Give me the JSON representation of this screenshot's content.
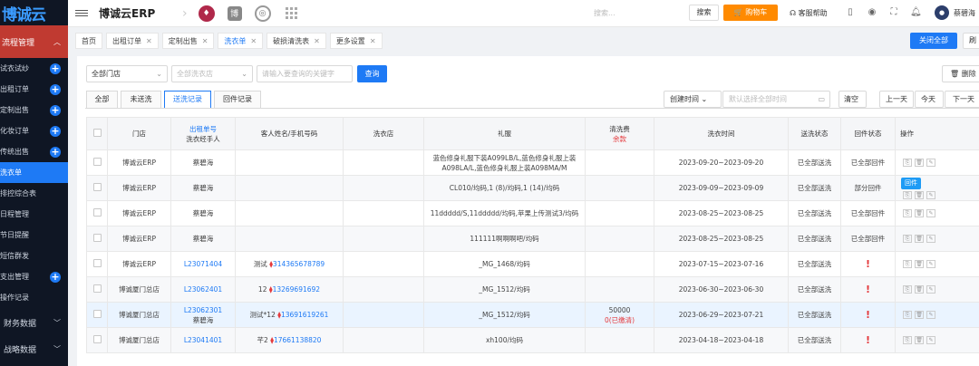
{
  "sidebar": {
    "logo": "博诚云",
    "group": "流程管理",
    "items": [
      {
        "label": "试衣试纱",
        "plus": true
      },
      {
        "label": "出租订单",
        "plus": true
      },
      {
        "label": "定制出售",
        "plus": true
      },
      {
        "label": "化妆订单",
        "plus": true
      },
      {
        "label": "传统出售",
        "plus": true
      },
      {
        "label": "洗衣单",
        "plus": false,
        "active": true
      },
      {
        "label": "排控综合表",
        "plus": false
      },
      {
        "label": "日程管理",
        "plus": false
      },
      {
        "label": "节日提醒",
        "plus": false
      },
      {
        "label": "短信群发",
        "plus": false
      },
      {
        "label": "支出管理",
        "plus": true
      },
      {
        "label": "操作记录",
        "plus": false
      }
    ],
    "sections": [
      "财务数据",
      "战略数据"
    ]
  },
  "topbar": {
    "brand": "博诚云ERP",
    "search_placeholder": "搜索...",
    "search_label": "搜索",
    "cart_label": "购物车",
    "help_label": "客服帮助",
    "username": "蔡碧海",
    "app_icons": [
      "person-icon",
      "book-icon",
      "swirl-icon",
      "grid-icon"
    ]
  },
  "page_tabs": [
    {
      "label": "首页",
      "closable": false
    },
    {
      "label": "出租订单",
      "closable": true
    },
    {
      "label": "定制出售",
      "closable": true
    },
    {
      "label": "洗衣单",
      "closable": true,
      "active": true
    },
    {
      "label": "破损清洗表",
      "closable": true
    },
    {
      "label": "更多设置",
      "closable": true
    }
  ],
  "close_all_label": "关闭全部",
  "refresh_label": "刷",
  "filters": {
    "store_select": "全部门店",
    "laundry_select": "全部洗衣店",
    "keyword_placeholder": "请输入要查询的关键字",
    "query_label": "查询",
    "delete_label": "删除"
  },
  "sub_tabs": [
    "全部",
    "未送洗",
    "送洗记录",
    "回件记录"
  ],
  "active_sub_tab": "送洗记录",
  "date_filter": {
    "created_label": "创建时间",
    "date_placeholder": "默认选择全部时间",
    "clear_label": "清空",
    "prev_day": "上一天",
    "today": "今天",
    "next_day": "下一天"
  },
  "table": {
    "headers": {
      "store": "门店",
      "order_no": "出租单号",
      "handler": "洗衣经手人",
      "customer": "客人姓名/手机号码",
      "laundry": "洗衣店",
      "dress": "礼服",
      "fee": "清洗费",
      "fee_sub": "余款",
      "wash_time": "洗衣时间",
      "send_status": "送洗状态",
      "return_status": "回件状态",
      "actions": "操作"
    },
    "rows": [
      {
        "store": "博诚云ERP",
        "order_no": "",
        "handler": "蔡碧海",
        "cust_name": "",
        "cust_phone": "",
        "laundry": "",
        "dress": "蓝色修身礼服下装A099LB/L,蓝色修身礼服上装A098LA/L,蓝色修身礼服上装A098MA/M",
        "fee": "",
        "fee_sub": "",
        "wash_time": "2023-09-20~2023-09-20",
        "send_status": "已全部送洗",
        "return_status": "已全部回件",
        "warn": false,
        "huijian": false
      },
      {
        "store": "博诚云ERP",
        "order_no": "",
        "handler": "蔡碧海",
        "cust_name": "",
        "cust_phone": "",
        "laundry": "",
        "dress": "CL010/均码,1 (8)/均码,1 (14)/均码",
        "fee": "",
        "fee_sub": "",
        "wash_time": "2023-09-09~2023-09-09",
        "send_status": "已全部送洗",
        "return_status": "部分回件",
        "warn": false,
        "huijian": true
      },
      {
        "store": "博诚云ERP",
        "order_no": "",
        "handler": "蔡碧海",
        "cust_name": "",
        "cust_phone": "",
        "laundry": "",
        "dress": "11ddddd/S,11ddddd/均码,苹果上传测试3/均码",
        "fee": "",
        "fee_sub": "",
        "wash_time": "2023-08-25~2023-08-25",
        "send_status": "已全部送洗",
        "return_status": "已全部回件",
        "warn": false,
        "huijian": false
      },
      {
        "store": "博诚云ERP",
        "order_no": "",
        "handler": "蔡碧海",
        "cust_name": "",
        "cust_phone": "",
        "laundry": "",
        "dress": "111111啊啊啊吧/均码",
        "fee": "",
        "fee_sub": "",
        "wash_time": "2023-08-25~2023-08-25",
        "send_status": "已全部送洗",
        "return_status": "已全部回件",
        "warn": false,
        "huijian": false
      },
      {
        "store": "博诚云ERP",
        "order_no": "L23071404",
        "handler": "",
        "cust_name": "测试",
        "cust_phone": "314365678789",
        "laundry": "",
        "dress": "_MG_1468/均码",
        "fee": "",
        "fee_sub": "",
        "wash_time": "2023-07-15~2023-07-16",
        "send_status": "已全部送洗",
        "return_status": "!",
        "warn": true,
        "huijian": false
      },
      {
        "store": "博诚厦门总店",
        "order_no": "L23062401",
        "handler": "",
        "cust_name": "12",
        "cust_phone": "13269691692",
        "laundry": "",
        "dress": "_MG_1512/均码",
        "fee": "",
        "fee_sub": "",
        "wash_time": "2023-06-30~2023-06-30",
        "send_status": "已全部送洗",
        "return_status": "!",
        "warn": true,
        "huijian": false
      },
      {
        "store": "博诚厦门总店",
        "order_no": "L23062301",
        "handler": "蔡碧海",
        "cust_name": "测试*12",
        "cust_phone": "13691619261",
        "laundry": "",
        "dress": "_MG_1512/均码",
        "fee": "50000",
        "fee_sub": "0(已缴清)",
        "wash_time": "2023-06-29~2023-07-21",
        "send_status": "已全部送洗",
        "return_status": "!",
        "warn": true,
        "huijian": false
      },
      {
        "store": "博诚厦门总店",
        "order_no": "L23041401",
        "handler": "",
        "cust_name": "芊2",
        "cust_phone": "17661138820",
        "laundry": "",
        "dress": "xh100/均码",
        "fee": "",
        "fee_sub": "",
        "wash_time": "2023-04-18~2023-04-18",
        "send_status": "已全部送洗",
        "return_status": "!",
        "warn": true,
        "huijian": false
      }
    ],
    "huijian_label": "回件"
  }
}
